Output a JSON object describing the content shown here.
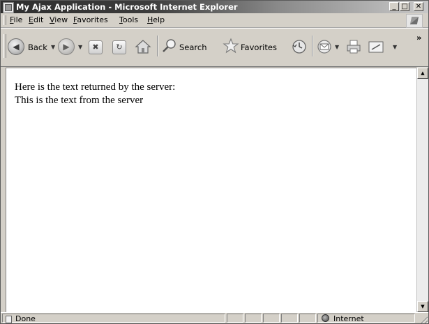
{
  "window": {
    "title": "My Ajax Application - Microsoft Internet Explorer",
    "minimize_glyph": "_",
    "maximize_glyph": "□",
    "close_glyph": "✕"
  },
  "menu": {
    "file": "File",
    "edit": "Edit",
    "view": "View",
    "favorites": "Favorites",
    "tools": "Tools",
    "help": "Help"
  },
  "toolbar": {
    "back_label": "Back",
    "search_label": "Search",
    "favorites_label": "Favorites",
    "overflow_glyph": "»",
    "dropdown_glyph": "▼"
  },
  "page": {
    "line1": "Here is the text returned by the server:",
    "line2": "This is the text from the server"
  },
  "status": {
    "text": "Done",
    "zone": "Internet"
  },
  "icons": {
    "back": "back-arrow-icon",
    "forward": "forward-arrow-icon",
    "stop": "stop-icon",
    "refresh": "refresh-icon",
    "home": "home-icon",
    "search": "search-icon",
    "favorites": "star-icon",
    "history": "history-icon",
    "mail": "mail-icon",
    "print": "printer-icon",
    "edit": "edit-icon"
  }
}
